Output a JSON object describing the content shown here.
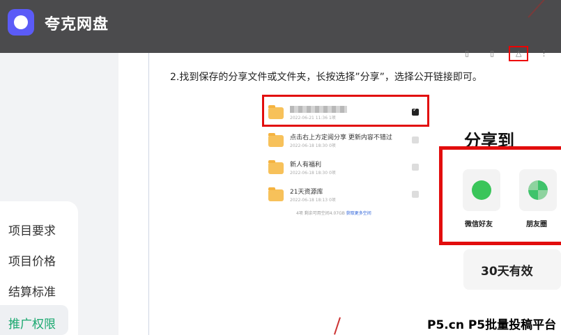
{
  "app": {
    "title": "夸克网盘"
  },
  "sidebar": {
    "items": [
      {
        "label": "项目要求"
      },
      {
        "label": "项目价格"
      },
      {
        "label": "结算标准"
      },
      {
        "label": "推广权限"
      }
    ]
  },
  "article": {
    "instruction": "2.找到保存的分享文件或文件夹，长按选择”分享”，选择公开链接即可。"
  },
  "files": [
    {
      "name": "",
      "date": "2022-06-21 11:36  1项"
    },
    {
      "name": "点击右上方定阅分享 更新内容不错过",
      "date": "2022-06-18 18:30  0项"
    },
    {
      "name": "新人有福利",
      "date": "2022-06-18 18:30  0项"
    },
    {
      "name": "21天资源库",
      "date": "2022-06-18 18:13  0项"
    }
  ],
  "storage": {
    "text": "4项 剩余可用空间4.07GB",
    "link": "获取更多空间"
  },
  "share": {
    "title": "分享到",
    "wechat": "微信好友",
    "moments": "朋友圈",
    "duration": "30天有效"
  },
  "watermark": "P5.cn P5批量投稿平台",
  "colors": {
    "accent": "#1aa86f",
    "highlight": "#e20d0d",
    "brand": "#5b5bf7"
  }
}
